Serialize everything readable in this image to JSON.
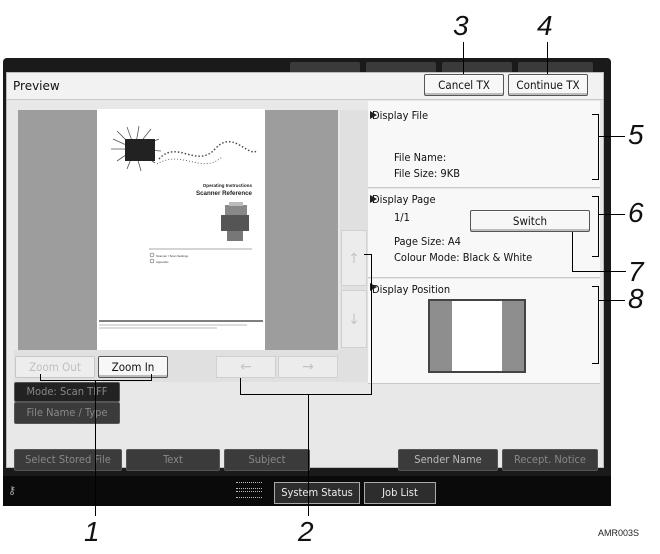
{
  "window": {
    "title": "Preview"
  },
  "top_buttons": {
    "cancel_tx": "Cancel TX",
    "continue_tx": "Continue TX"
  },
  "preview_controls": {
    "zoom_out": "Zoom Out",
    "zoom_in": "Zoom In",
    "left_arrow": "←",
    "right_arrow": "→",
    "up_arrow": "↑",
    "down_arrow": "↓"
  },
  "document_page": {
    "title_line1": "Operating Instructions",
    "title_line2": "Scanner Reference",
    "toc": [
      "Scanner / Scan Settings",
      "Appendix"
    ]
  },
  "display_file": {
    "header": "Display File",
    "file_name_label": "File Name:",
    "file_size": "File Size: 9KB"
  },
  "display_page": {
    "header": "Display Page",
    "page_counter": "1/1",
    "switch_button": "Switch",
    "page_size": "Page Size: A4",
    "colour_mode": "Colour Mode: Black & White"
  },
  "display_position": {
    "header": "Display Position"
  },
  "device_buttons": {
    "mode_label": "Mode: Scan TIFF",
    "file_name_type": "File Name / Type",
    "select_stored_file": "Select Stored File",
    "text": "Text",
    "subject": "Subject",
    "sender_name": "Sender Name",
    "recept_notice": "Recept. Notice",
    "system_status": "System Status",
    "job_list": "Job List"
  },
  "callouts": [
    "1",
    "2",
    "3",
    "4",
    "5",
    "6",
    "7",
    "8"
  ],
  "figure_code": "AMR003S"
}
